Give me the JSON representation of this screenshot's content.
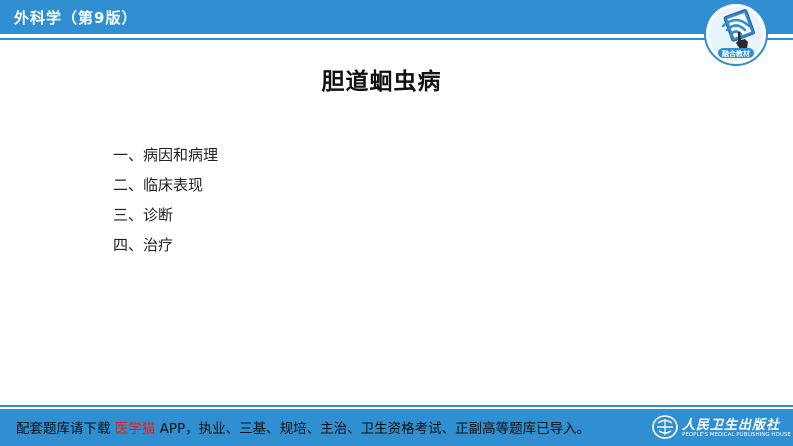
{
  "header": {
    "title": "外科学（第9版）",
    "badge_label": "融合教材"
  },
  "main": {
    "title": "胆道蛔虫病",
    "toc": [
      "一、病因和病理",
      "二、临床表现",
      "三、诊断",
      "四、治疗"
    ]
  },
  "footer": {
    "text_prefix": "配套题库请下载 ",
    "app_name": "医学猫",
    "text_suffix": " APP，执业、三基、规培、主治、卫生资格考试、正副高等题库已导入。",
    "publisher_cn": "人民卫生出版社",
    "publisher_en": "PEOPLE'S MEDICAL PUBLISHING HOUSE"
  },
  "colors": {
    "accent": "#2f8fd0",
    "highlight": "#e02020"
  },
  "icons": {
    "badge": "wifi-hand-icon",
    "publisher": "pmph-logo-icon"
  }
}
